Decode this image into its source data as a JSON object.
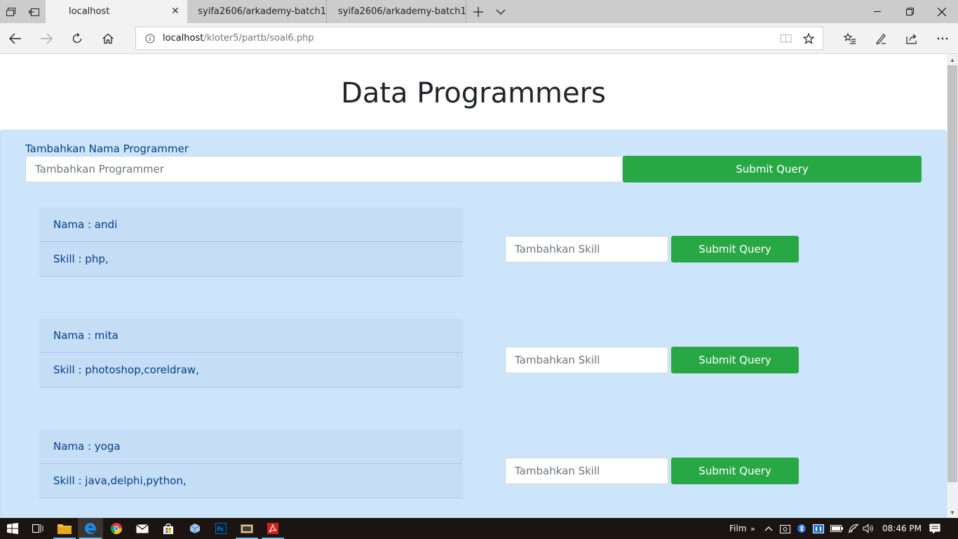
{
  "browser": {
    "tabs": [
      {
        "title": "localhost",
        "active": true
      },
      {
        "title": "syifa2606/arkademy-batch1",
        "active": false
      },
      {
        "title": "syifa2606/arkademy-batch1",
        "active": false
      }
    ],
    "address": {
      "host": "localhost",
      "path": "/kloter5/partb/soal6.php"
    }
  },
  "page": {
    "title": "Data Programmers",
    "add_programmer": {
      "label": "Tambahkan Nama Programmer",
      "placeholder": "Tambahkan Programmer",
      "button": "Submit Query"
    },
    "programmers": [
      {
        "name": "Nama : andi",
        "skill": "Skill : php,",
        "skill_placeholder": "Tambahkan Skill",
        "button": "Submit Query"
      },
      {
        "name": "Nama : mita",
        "skill": "Skill : photoshop,coreldraw,",
        "skill_placeholder": "Tambahkan Skill",
        "button": "Submit Query"
      },
      {
        "name": "Nama : yoga",
        "skill": "Skill : java,delphi,python,",
        "skill_placeholder": "Tambahkan Skill",
        "button": "Submit Query"
      }
    ]
  },
  "taskbar": {
    "tray_label": "Film",
    "time": "08:46 PM"
  },
  "colors": {
    "panel": "#cce5fb",
    "button": "#28a745",
    "text_primary": "#004085"
  }
}
